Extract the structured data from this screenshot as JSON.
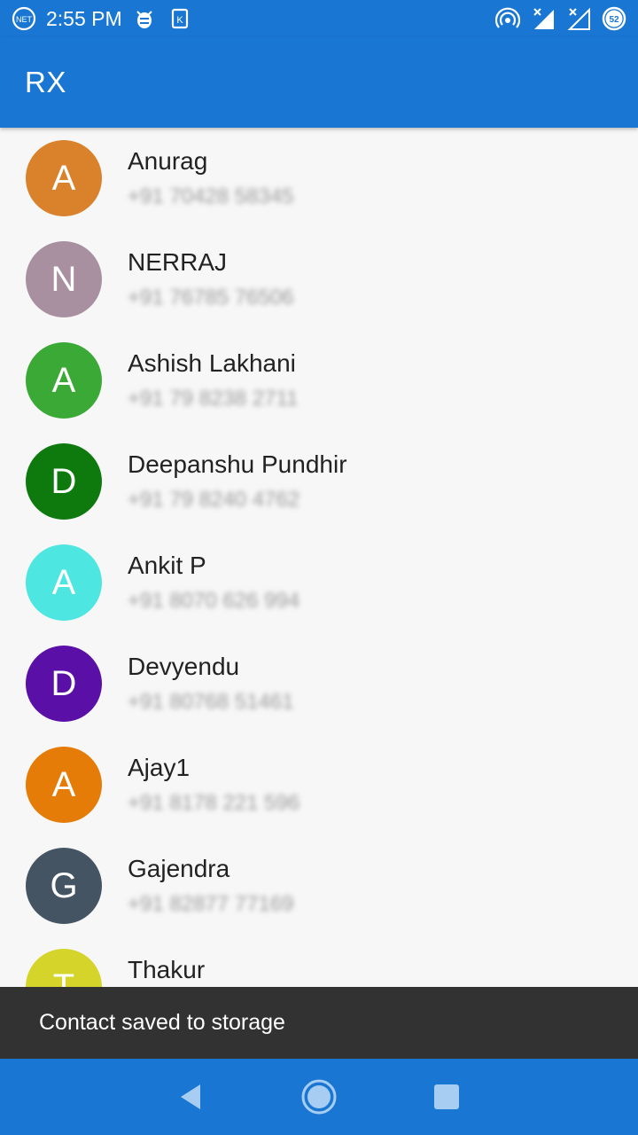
{
  "status_bar": {
    "time": "2:55 PM",
    "battery": "52",
    "icons": [
      "vpn-icon",
      "bug-icon",
      "k-icon",
      "hotspot-icon",
      "signal-icon",
      "signal-icon",
      "battery-icon"
    ]
  },
  "app_bar": {
    "title": "RX"
  },
  "contacts": [
    {
      "initial": "A",
      "name": "Anurag",
      "phone": "+91 70428 58345",
      "color": "#d9822b"
    },
    {
      "initial": "N",
      "name": "NERRAJ",
      "phone": "+91 76785 76506",
      "color": "#a890a0"
    },
    {
      "initial": "A",
      "name": "Ashish Lakhani",
      "phone": "+91 79 8238 2711",
      "color": "#3aa935"
    },
    {
      "initial": "D",
      "name": "Deepanshu Pundhir",
      "phone": "+91 79 8240 4762",
      "color": "#0e7a0e"
    },
    {
      "initial": "A",
      "name": "Ankit P",
      "phone": "+91 8070 626 994",
      "color": "#4ee6e0"
    },
    {
      "initial": "D",
      "name": "Devyendu",
      "phone": "+91 80768 51461",
      "color": "#5a0fa6"
    },
    {
      "initial": "A",
      "name": "Ajay1",
      "phone": "+91 8178 221 596",
      "color": "#e67c08"
    },
    {
      "initial": "G",
      "name": "Gajendra",
      "phone": "+91 82877 77169",
      "color": "#455463"
    },
    {
      "initial": "T",
      "name": "Thakur",
      "phone": "",
      "color": "#d4d42a"
    }
  ],
  "snackbar": {
    "message": "Contact saved to storage"
  },
  "nav_bar": {
    "icons": [
      "back-icon",
      "home-icon",
      "recents-icon"
    ]
  }
}
